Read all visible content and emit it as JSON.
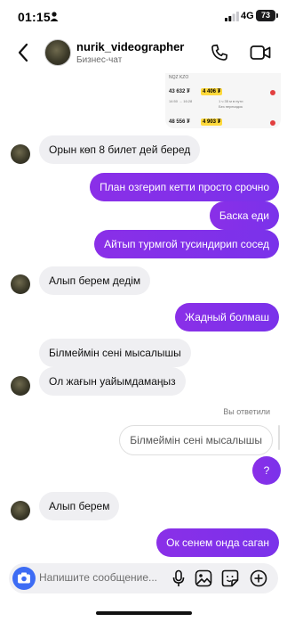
{
  "status_bar": {
    "time": "01:15",
    "network": "4G",
    "battery": "73"
  },
  "header": {
    "name": "nurik_videographer",
    "subtitle": "Бизнес-чат"
  },
  "shared_image": {
    "rows": [
      {
        "price": "43 632 ₮",
        "badge": "4 406 ₮",
        "route": "NQZ  KZO",
        "note": "Без пересадок"
      },
      {
        "price": "48 556 ₮",
        "badge": "4 903 ₮",
        "route": "14:50 → 16:28",
        "note": "1 ч 35 м в пути"
      }
    ]
  },
  "messages": [
    {
      "side": "in",
      "text": "Орын көп 8 билет дей беред"
    },
    {
      "side": "out",
      "text": "План озгерип кетти просто срочно"
    },
    {
      "side": "out",
      "text": "Баска еди"
    },
    {
      "side": "out",
      "text": "Айтып турмгой тусиндирип сосед"
    },
    {
      "side": "in",
      "text": "Алып берем дедім"
    },
    {
      "side": "out",
      "text": "Жадный болмаш"
    },
    {
      "side": "in",
      "text": "Білмеймін сені мысалышы"
    },
    {
      "side": "in",
      "text": "Ол жағын уайымдамаңыз"
    },
    {
      "side": "meta",
      "text": "Вы ответили"
    },
    {
      "side": "quote",
      "text": "Білмеймін сені мысалышы"
    },
    {
      "side": "out",
      "text": "?"
    },
    {
      "side": "in",
      "text": "Алып берем"
    },
    {
      "side": "out",
      "text": "Ок сенем онда саган"
    }
  ],
  "composer": {
    "placeholder": "Напишите сообщение..."
  },
  "colors": {
    "accent": "#7a32ea",
    "camera": "#3d6cf4",
    "incoming": "#efeff2"
  },
  "icons": [
    "back-icon",
    "phone-icon",
    "video-icon",
    "camera-icon",
    "mic-icon",
    "gallery-icon",
    "sticker-icon",
    "plus-icon"
  ]
}
